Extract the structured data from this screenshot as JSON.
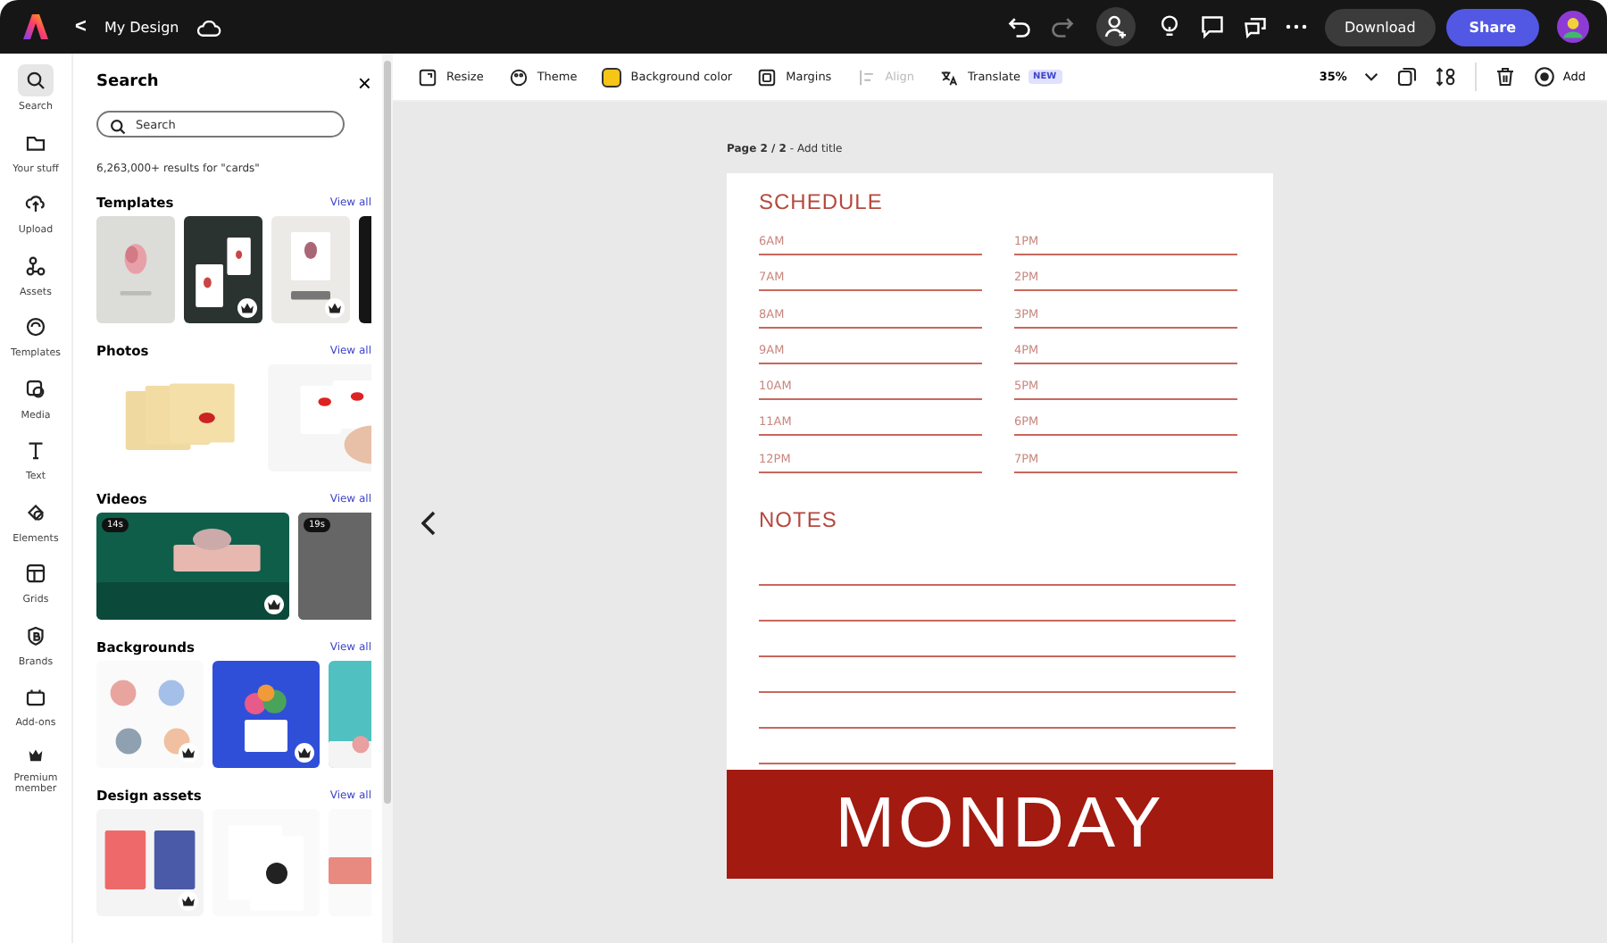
{
  "topbar": {
    "back": "<",
    "title": "My Design",
    "download": "Download",
    "share": "Share"
  },
  "rail": [
    {
      "label": "Search",
      "selected": true
    },
    {
      "label": "Your stuff",
      "selected": false
    },
    {
      "label": "Upload",
      "selected": false
    },
    {
      "label": "Assets",
      "selected": false
    },
    {
      "label": "Templates",
      "selected": false
    },
    {
      "label": "Media",
      "selected": false
    },
    {
      "label": "Text",
      "selected": false
    },
    {
      "label": "Elements",
      "selected": false
    },
    {
      "label": "Grids",
      "selected": false
    },
    {
      "label": "Brands",
      "selected": false
    },
    {
      "label": "Add-ons",
      "selected": false
    },
    {
      "label": "Premium member",
      "selected": false
    }
  ],
  "panel": {
    "title": "Search",
    "close": "×",
    "search_placeholder": "Search",
    "results": "6,263,000+ results for \"cards\"",
    "sections": [
      {
        "title": "Templates",
        "link": "View all",
        "items": [
          {
            "kind": "picture",
            "premium": false
          },
          {
            "kind": "picture",
            "premium": true
          },
          {
            "kind": "picture",
            "premium": true
          },
          {
            "kind": "picture"
          }
        ]
      },
      {
        "title": "Photos",
        "link": "View all",
        "items": [
          {
            "kind": "picture",
            "premium": false
          },
          {
            "kind": "picture"
          }
        ]
      },
      {
        "title": "Videos",
        "link": "View all",
        "items": [
          {
            "kind": "picture",
            "badge": "14s",
            "premium": true
          },
          {
            "kind": "picture",
            "badge": "19s"
          }
        ]
      },
      {
        "title": "Backgrounds",
        "link": "View all",
        "items": [
          {
            "kind": "picture",
            "premium": true
          },
          {
            "kind": "picture",
            "premium": true
          },
          {
            "kind": "picture"
          }
        ]
      },
      {
        "title": "Design assets",
        "link": "View all",
        "items": [
          {
            "kind": "picture",
            "premium": true
          },
          {
            "kind": "picture",
            "premium": false
          },
          {
            "kind": "picture"
          }
        ]
      }
    ]
  },
  "toolbar": [
    {
      "label": "Resize",
      "disabled": false
    },
    {
      "label": "Theme",
      "disabled": false
    },
    {
      "label": "Background color",
      "color": "#f5c518",
      "disabled": false
    },
    {
      "label": "Margins",
      "disabled": false
    },
    {
      "label": "Align",
      "disabled": true
    },
    {
      "label": "Translate",
      "badge": "NEW",
      "disabled": false
    }
  ],
  "zoom": "35%",
  "add": "Add",
  "page": {
    "label": "**Page 2 / 2** - Add title",
    "schedule_title": "SCHEDULE",
    "times_left": [
      "6AM",
      "7AM",
      "8AM",
      "9AM",
      "10AM",
      "11AM",
      "12PM"
    ],
    "times_right": [
      "1PM",
      "2PM",
      "3PM",
      "4PM",
      "5PM",
      "6PM",
      "7PM"
    ],
    "notes_title": "NOTES",
    "banner": "MONDAY"
  }
}
